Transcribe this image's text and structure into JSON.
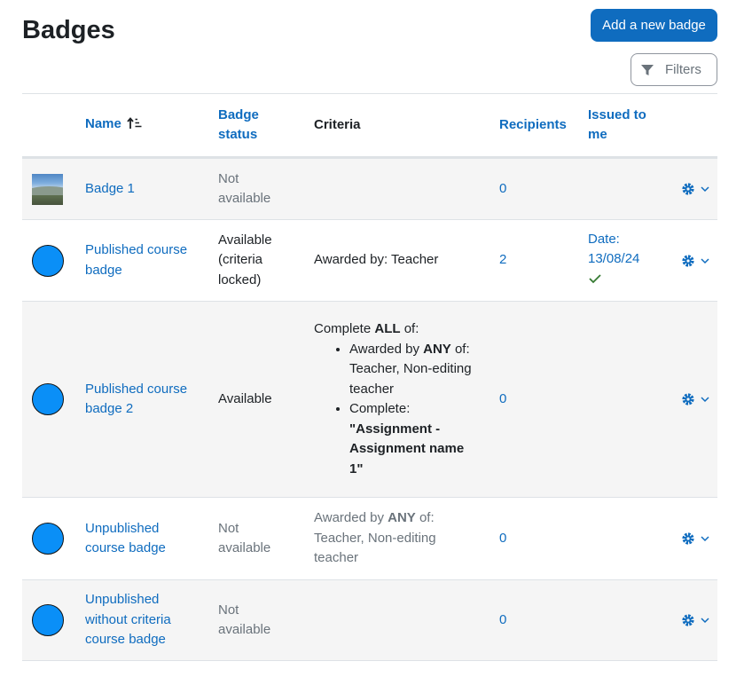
{
  "page": {
    "title": "Badges",
    "add_button_label": "Add a new badge",
    "filters_label": "Filters"
  },
  "table": {
    "headers": {
      "name": "Name",
      "badge_status_line1": "Badge",
      "badge_status_line2": "status",
      "criteria": "Criteria",
      "recipients": "Recipients",
      "issued_line1": "Issued to",
      "issued_line2": "me"
    },
    "rows": [
      {
        "name": "Badge 1",
        "status_line1": "Not",
        "status_line2": "available",
        "recipients": "0"
      },
      {
        "name_line1": "Published course",
        "name_line2": "badge",
        "status_line1": "Available",
        "status_line2": "(criteria",
        "status_line3": "locked)",
        "criteria": "Awarded by: Teacher",
        "recipients": "2",
        "issued_line1": "Date:",
        "issued_line2": "13/08/24"
      },
      {
        "name_line1": "Published course",
        "name_line2": "badge 2",
        "status": "Available",
        "criteria": {
          "intro_prefix": "Complete ",
          "intro_bold": "ALL",
          "intro_suffix": " of:",
          "item1_prefix": "Awarded by ",
          "item1_bold": "ANY",
          "item1_suffix": " of:",
          "item1_line2": "Teacher, Non-editing",
          "item1_line3": "teacher",
          "item2_label": "Complete:",
          "item2_bold_line1": "\"Assignment -",
          "item2_bold_line2": "Assignment name",
          "item2_bold_line3": "1\""
        },
        "recipients": "0"
      },
      {
        "name_line1": "Unpublished",
        "name_line2": "course badge",
        "status_line1": "Not",
        "status_line2": "available",
        "criteria": {
          "prefix": "Awarded by ",
          "bold": "ANY",
          "suffix": " of:",
          "line2": "Teacher, Non-editing",
          "line3": "teacher"
        },
        "recipients": "0"
      },
      {
        "name_line1": "Unpublished",
        "name_line2": "without criteria",
        "name_line3": "course badge",
        "status_line1": "Not",
        "status_line2": "available",
        "recipients": "0"
      }
    ]
  },
  "icons": {
    "sort": "sort-ascending-icon",
    "filter": "filter-icon",
    "gear": "gear-icon",
    "chevron": "chevron-down-icon",
    "check": "check-icon"
  },
  "colors": {
    "primary": "#0f6cbf",
    "link": "#0f6cbf",
    "muted_text": "#6a737b",
    "badge_fill": "#0a8ff7",
    "check": "#357a32",
    "row_stripe": "#f5f5f5"
  }
}
